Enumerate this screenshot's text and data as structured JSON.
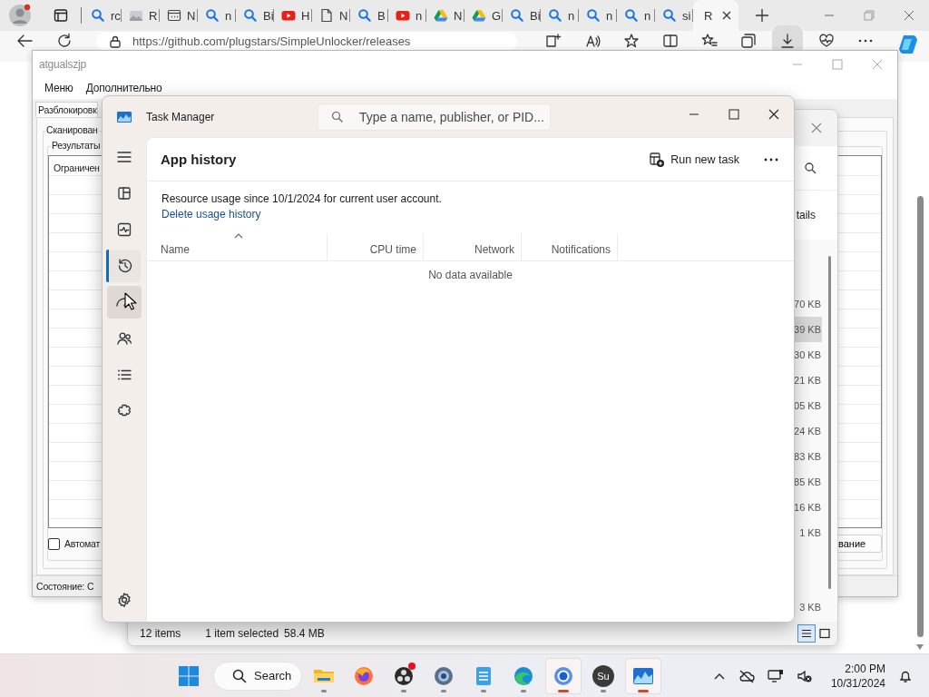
{
  "browser": {
    "tabs": [
      {
        "kind": "search",
        "label": "rc",
        "selected": false
      },
      {
        "kind": "image",
        "label": "R",
        "selected": false
      },
      {
        "kind": "window",
        "label": "N",
        "selected": false
      },
      {
        "kind": "search",
        "label": "n",
        "selected": false
      },
      {
        "kind": "search",
        "label": "Bi",
        "selected": false
      },
      {
        "kind": "video",
        "label": "H",
        "selected": false
      },
      {
        "kind": "doc",
        "label": "N",
        "selected": false
      },
      {
        "kind": "search",
        "label": "B",
        "selected": false
      },
      {
        "kind": "video",
        "label": "n",
        "selected": false
      },
      {
        "kind": "drive",
        "label": "N",
        "selected": false
      },
      {
        "kind": "drive",
        "label": "G",
        "selected": false
      },
      {
        "kind": "search",
        "label": "Bi",
        "selected": false
      },
      {
        "kind": "search",
        "label": "n",
        "selected": false
      },
      {
        "kind": "search",
        "label": "n",
        "selected": false
      },
      {
        "kind": "search",
        "label": "n",
        "selected": false
      },
      {
        "kind": "search",
        "label": "si",
        "selected": false
      },
      {
        "label": "R",
        "selected": true
      }
    ],
    "address": "https://github.com/plugstars/SimpleUnlocker/releases"
  },
  "unlocker_window": {
    "title": "atgualszjp",
    "menu": [
      "Меню",
      "Дополнительно"
    ],
    "tab": "Разблокировк",
    "group": "Сканирован",
    "subgroup": "Результаты",
    "list_rows": [
      "Ограничен"
    ],
    "checkbox": {
      "label": "Автомат",
      "checked": false
    },
    "button": "вание",
    "status": "Состояние: С"
  },
  "background_window": {
    "command": "tails",
    "rows": [
      {
        "value": "70 KB",
        "selected": false
      },
      {
        "value": "39 KB",
        "selected": true
      },
      {
        "value": "30 KB",
        "selected": false
      },
      {
        "value": "21 KB",
        "selected": false
      },
      {
        "value": "05 KB",
        "selected": false
      },
      {
        "value": "24 KB",
        "selected": false
      },
      {
        "value": "83 KB",
        "selected": false
      },
      {
        "value": "85 KB",
        "selected": false
      },
      {
        "value": "16 KB",
        "selected": false
      },
      {
        "value": "1 KB",
        "selected": false
      }
    ],
    "last_row": "3 KB",
    "status_items": "12 items",
    "status_selected": "1 item selected",
    "status_size": "58.4 MB",
    "views": [
      {
        "kind": "details",
        "selected": true
      },
      {
        "kind": "tiles",
        "selected": false
      }
    ]
  },
  "task_manager": {
    "title": "Task Manager",
    "search_placeholder": "Type a name, publisher, or PID...",
    "nav": [
      {
        "kind": "menu",
        "selected": false,
        "hovered": false
      },
      {
        "kind": "processes",
        "selected": false,
        "hovered": false
      },
      {
        "kind": "performance",
        "selected": false,
        "hovered": false
      },
      {
        "kind": "history",
        "selected": true,
        "hovered": false
      },
      {
        "kind": "startup",
        "selected": false,
        "hovered": true
      },
      {
        "kind": "users",
        "selected": false,
        "hovered": false
      },
      {
        "kind": "details",
        "selected": false,
        "hovered": false
      },
      {
        "kind": "services",
        "selected": false,
        "hovered": false
      },
      {
        "kind": "settings",
        "selected": false,
        "hovered": false
      }
    ],
    "page_title": "App history",
    "run_new_task": "Run new task",
    "info": "Resource usage since 10/1/2024 for current user account.",
    "link": "Delete usage history",
    "columns": [
      {
        "label": "Name",
        "sorted": true
      },
      {
        "label": "CPU time",
        "sorted": false
      },
      {
        "label": "Network",
        "sorted": false
      },
      {
        "label": "Notifications",
        "sorted": false
      }
    ],
    "empty": "No data available"
  },
  "taskbar": {
    "search": "Search",
    "apps": [
      {
        "kind": "explorer",
        "running": true,
        "active": false,
        "badge": false
      },
      {
        "kind": "firefox",
        "running": false,
        "active": false,
        "badge": false
      },
      {
        "kind": "obs",
        "running": true,
        "active": false,
        "badge": true
      },
      {
        "kind": "settings",
        "running": true,
        "active": false,
        "badge": false
      },
      {
        "kind": "notepad",
        "running": true,
        "active": false,
        "badge": false
      },
      {
        "kind": "edge",
        "running": true,
        "active": false,
        "badge": false
      },
      {
        "kind": "chrome",
        "running": true,
        "active": true,
        "badge": false
      },
      {
        "kind": "letters",
        "label": "Su",
        "running": true,
        "active": false,
        "badge": false
      },
      {
        "kind": "taskmanager",
        "running": true,
        "active": true,
        "badge": false
      }
    ],
    "time": "2:00 PM",
    "date": "10/31/2024"
  }
}
